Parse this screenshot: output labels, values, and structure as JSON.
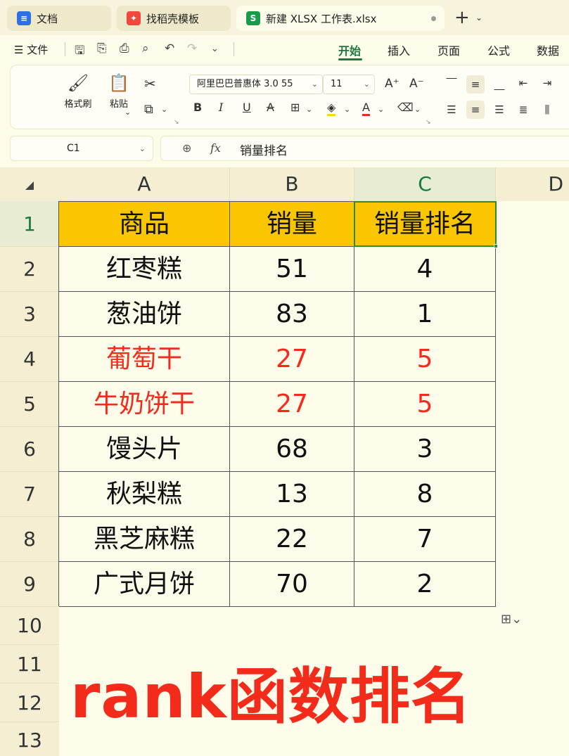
{
  "tabs": [
    {
      "label": "文档",
      "icon": "doc-icon",
      "color": "#2f6fe4"
    },
    {
      "label": "找稻壳模板",
      "icon": "docer-icon",
      "color": "#f0493c"
    },
    {
      "label": "新建 XLSX 工作表.xlsx",
      "icon": "sheet-icon",
      "icon_text": "S",
      "color": "#1a9a4b",
      "active": true
    }
  ],
  "menu": {
    "file_label": "文件",
    "ribbon_tabs": [
      "开始",
      "插入",
      "页面",
      "公式",
      "数据"
    ],
    "active_tab": "开始"
  },
  "ribbon": {
    "format_painter": "格式刷",
    "paste": "粘贴",
    "font_name": "阿里巴巴普惠体 3.0 55",
    "font_size": "11"
  },
  "formula_bar": {
    "cell_ref": "C1",
    "fx_label": "fx",
    "value": "销量排名"
  },
  "sheet": {
    "columns": [
      "A",
      "B",
      "C",
      "D"
    ],
    "selected_column": "C",
    "rows": [
      "1",
      "2",
      "3",
      "4",
      "5",
      "6",
      "7",
      "8",
      "9",
      "10",
      "11",
      "12",
      "13"
    ],
    "selected_row": "1",
    "header": [
      "商品",
      "销量",
      "销量排名"
    ],
    "data": [
      {
        "name": "红枣糕",
        "sales": "51",
        "rank": "4",
        "highlight": false
      },
      {
        "name": "葱油饼",
        "sales": "83",
        "rank": "1",
        "highlight": false
      },
      {
        "name": "葡萄干",
        "sales": "27",
        "rank": "5",
        "highlight": true
      },
      {
        "name": "牛奶饼干",
        "sales": "27",
        "rank": "5",
        "highlight": true
      },
      {
        "name": "馒头片",
        "sales": "68",
        "rank": "3",
        "highlight": false
      },
      {
        "name": "秋梨糕",
        "sales": "13",
        "rank": "8",
        "highlight": false
      },
      {
        "name": "黑芝麻糕",
        "sales": "22",
        "rank": "7",
        "highlight": false
      },
      {
        "name": "广式月饼",
        "sales": "70",
        "rank": "2",
        "highlight": false
      }
    ],
    "header_fill": "#f9c600",
    "highlight_color": "#f22b1b"
  },
  "overlay_title": "rank函数排名"
}
